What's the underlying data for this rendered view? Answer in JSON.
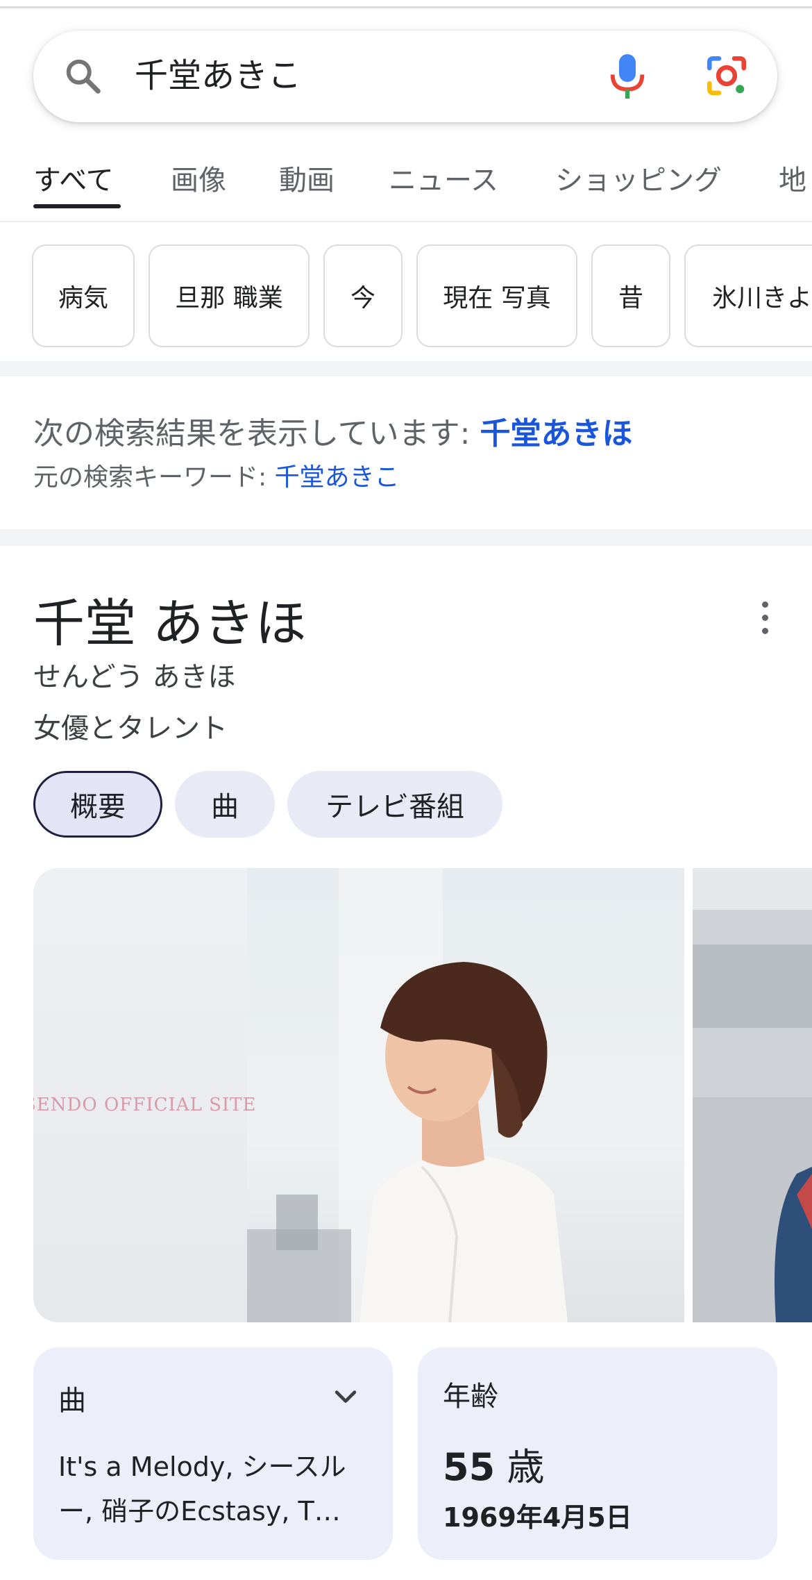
{
  "search": {
    "query": "千堂あきこ"
  },
  "tabs": [
    "すべて",
    "画像",
    "動画",
    "ニュース",
    "ショッピング",
    "地"
  ],
  "chips": [
    "病気",
    "旦那 職業",
    "今",
    "現在 写真",
    "昔",
    "氷川きよ"
  ],
  "correction": {
    "showing_prefix": "次の検索結果を表示しています: ",
    "corrected": "千堂あきほ",
    "original_prefix": "元の検索キーワード: ",
    "original": "千堂あきこ"
  },
  "panel": {
    "title": "千堂 あきほ",
    "reading": "せんどう あきほ",
    "description": "女優とタレント",
    "tabs": [
      "概要",
      "曲",
      "テレビ番組"
    ],
    "photo_caption": "SENDO OFFICIAL SITE"
  },
  "cards": {
    "songs_label": "曲",
    "songs_line1": "It's a Melody, シースル",
    "songs_line2": "ー, 硝子のEcstasy, T…",
    "age_label": "年齢",
    "age_number": "55",
    "age_unit": " 歳",
    "birthdate": "1969年4月5日"
  },
  "colors": {
    "link": "#1a56db",
    "card_bg": "#eceefa",
    "chip_border": "#dadce0"
  }
}
